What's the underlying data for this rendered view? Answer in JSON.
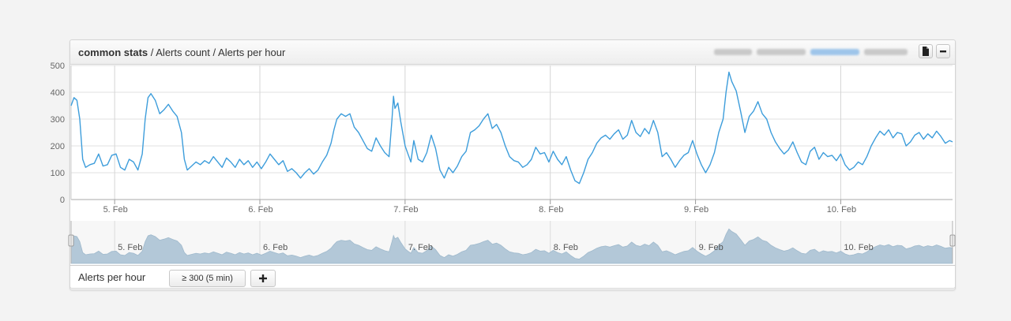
{
  "header": {
    "path_bold": "common stats",
    "path_rest": " / Alerts count / Alerts per hour"
  },
  "footer": {
    "series_label": "Alerts per hour",
    "threshold_button": "≥ 300 (5 min)",
    "add_button": "+"
  },
  "icons": {
    "doc": "document-icon",
    "minimize": "minus-icon",
    "add": "plus-icon"
  },
  "colors": {
    "line": "#3d9ddb",
    "navigator_fill": "#b3c8d8",
    "grid": "#e2e2e2"
  },
  "chart_data": {
    "type": "line",
    "ylim": [
      0,
      500
    ],
    "yticks": [
      0,
      100,
      200,
      300,
      400,
      500
    ],
    "xlim_days": [
      4.7,
      10.77
    ],
    "xticks": [
      {
        "value": 5,
        "label": "5. Feb"
      },
      {
        "value": 6,
        "label": "6. Feb"
      },
      {
        "value": 7,
        "label": "7. Feb"
      },
      {
        "value": 8,
        "label": "8. Feb"
      },
      {
        "value": 9,
        "label": "9. Feb"
      },
      {
        "value": 10,
        "label": "10. Feb"
      }
    ],
    "series": [
      {
        "points": [
          [
            4.7,
            350
          ],
          [
            4.72,
            380
          ],
          [
            4.74,
            370
          ],
          [
            4.76,
            300
          ],
          [
            4.78,
            150
          ],
          [
            4.8,
            120
          ],
          [
            4.83,
            130
          ],
          [
            4.86,
            135
          ],
          [
            4.89,
            170
          ],
          [
            4.92,
            125
          ],
          [
            4.95,
            130
          ],
          [
            4.98,
            165
          ],
          [
            5.01,
            170
          ],
          [
            5.04,
            120
          ],
          [
            5.07,
            110
          ],
          [
            5.1,
            150
          ],
          [
            5.13,
            140
          ],
          [
            5.16,
            110
          ],
          [
            5.19,
            170
          ],
          [
            5.21,
            300
          ],
          [
            5.23,
            380
          ],
          [
            5.25,
            395
          ],
          [
            5.28,
            370
          ],
          [
            5.31,
            320
          ],
          [
            5.34,
            335
          ],
          [
            5.37,
            355
          ],
          [
            5.4,
            330
          ],
          [
            5.43,
            310
          ],
          [
            5.46,
            250
          ],
          [
            5.48,
            150
          ],
          [
            5.5,
            110
          ],
          [
            5.53,
            125
          ],
          [
            5.56,
            140
          ],
          [
            5.59,
            130
          ],
          [
            5.62,
            145
          ],
          [
            5.65,
            135
          ],
          [
            5.68,
            160
          ],
          [
            5.71,
            140
          ],
          [
            5.74,
            120
          ],
          [
            5.77,
            155
          ],
          [
            5.8,
            140
          ],
          [
            5.83,
            120
          ],
          [
            5.86,
            150
          ],
          [
            5.89,
            130
          ],
          [
            5.92,
            145
          ],
          [
            5.95,
            120
          ],
          [
            5.98,
            140
          ],
          [
            6.01,
            115
          ],
          [
            6.04,
            140
          ],
          [
            6.07,
            170
          ],
          [
            6.1,
            150
          ],
          [
            6.13,
            130
          ],
          [
            6.16,
            145
          ],
          [
            6.19,
            105
          ],
          [
            6.22,
            115
          ],
          [
            6.25,
            100
          ],
          [
            6.28,
            80
          ],
          [
            6.31,
            100
          ],
          [
            6.34,
            115
          ],
          [
            6.37,
            95
          ],
          [
            6.4,
            110
          ],
          [
            6.43,
            140
          ],
          [
            6.46,
            165
          ],
          [
            6.49,
            210
          ],
          [
            6.51,
            260
          ],
          [
            6.53,
            300
          ],
          [
            6.56,
            320
          ],
          [
            6.59,
            310
          ],
          [
            6.62,
            320
          ],
          [
            6.65,
            270
          ],
          [
            6.68,
            250
          ],
          [
            6.71,
            220
          ],
          [
            6.74,
            190
          ],
          [
            6.77,
            180
          ],
          [
            6.8,
            230
          ],
          [
            6.83,
            200
          ],
          [
            6.86,
            175
          ],
          [
            6.89,
            160
          ],
          [
            6.91,
            300
          ],
          [
            6.92,
            385
          ],
          [
            6.93,
            340
          ],
          [
            6.95,
            360
          ],
          [
            6.97,
            290
          ],
          [
            7.0,
            200
          ],
          [
            7.02,
            170
          ],
          [
            7.04,
            140
          ],
          [
            7.06,
            220
          ],
          [
            7.09,
            150
          ],
          [
            7.12,
            140
          ],
          [
            7.15,
            175
          ],
          [
            7.18,
            240
          ],
          [
            7.21,
            190
          ],
          [
            7.24,
            110
          ],
          [
            7.27,
            80
          ],
          [
            7.3,
            120
          ],
          [
            7.33,
            100
          ],
          [
            7.36,
            125
          ],
          [
            7.39,
            160
          ],
          [
            7.42,
            180
          ],
          [
            7.45,
            250
          ],
          [
            7.48,
            260
          ],
          [
            7.51,
            275
          ],
          [
            7.54,
            300
          ],
          [
            7.57,
            320
          ],
          [
            7.6,
            265
          ],
          [
            7.63,
            280
          ],
          [
            7.66,
            250
          ],
          [
            7.69,
            200
          ],
          [
            7.72,
            160
          ],
          [
            7.75,
            145
          ],
          [
            7.78,
            140
          ],
          [
            7.81,
            120
          ],
          [
            7.84,
            130
          ],
          [
            7.87,
            150
          ],
          [
            7.9,
            195
          ],
          [
            7.93,
            170
          ],
          [
            7.96,
            175
          ],
          [
            7.99,
            140
          ],
          [
            8.02,
            180
          ],
          [
            8.05,
            150
          ],
          [
            8.08,
            130
          ],
          [
            8.11,
            160
          ],
          [
            8.14,
            110
          ],
          [
            8.17,
            70
          ],
          [
            8.2,
            60
          ],
          [
            8.23,
            100
          ],
          [
            8.26,
            150
          ],
          [
            8.29,
            175
          ],
          [
            8.32,
            210
          ],
          [
            8.35,
            230
          ],
          [
            8.38,
            240
          ],
          [
            8.41,
            225
          ],
          [
            8.44,
            245
          ],
          [
            8.47,
            260
          ],
          [
            8.5,
            225
          ],
          [
            8.53,
            240
          ],
          [
            8.56,
            295
          ],
          [
            8.59,
            250
          ],
          [
            8.62,
            235
          ],
          [
            8.65,
            265
          ],
          [
            8.68,
            245
          ],
          [
            8.71,
            295
          ],
          [
            8.74,
            250
          ],
          [
            8.77,
            160
          ],
          [
            8.8,
            175
          ],
          [
            8.83,
            150
          ],
          [
            8.86,
            120
          ],
          [
            8.89,
            145
          ],
          [
            8.92,
            165
          ],
          [
            8.95,
            175
          ],
          [
            8.98,
            220
          ],
          [
            9.01,
            170
          ],
          [
            9.04,
            130
          ],
          [
            9.07,
            100
          ],
          [
            9.1,
            130
          ],
          [
            9.13,
            175
          ],
          [
            9.16,
            250
          ],
          [
            9.19,
            300
          ],
          [
            9.21,
            400
          ],
          [
            9.23,
            475
          ],
          [
            9.25,
            440
          ],
          [
            9.28,
            405
          ],
          [
            9.31,
            330
          ],
          [
            9.34,
            250
          ],
          [
            9.37,
            310
          ],
          [
            9.4,
            330
          ],
          [
            9.43,
            365
          ],
          [
            9.46,
            320
          ],
          [
            9.49,
            300
          ],
          [
            9.52,
            250
          ],
          [
            9.55,
            215
          ],
          [
            9.58,
            190
          ],
          [
            9.61,
            170
          ],
          [
            9.64,
            185
          ],
          [
            9.67,
            215
          ],
          [
            9.7,
            175
          ],
          [
            9.73,
            140
          ],
          [
            9.76,
            130
          ],
          [
            9.79,
            180
          ],
          [
            9.82,
            195
          ],
          [
            9.85,
            150
          ],
          [
            9.88,
            175
          ],
          [
            9.91,
            160
          ],
          [
            9.94,
            165
          ],
          [
            9.97,
            145
          ],
          [
            10.0,
            170
          ],
          [
            10.03,
            130
          ],
          [
            10.06,
            110
          ],
          [
            10.09,
            120
          ],
          [
            10.12,
            140
          ],
          [
            10.15,
            130
          ],
          [
            10.18,
            160
          ],
          [
            10.21,
            200
          ],
          [
            10.24,
            230
          ],
          [
            10.27,
            255
          ],
          [
            10.3,
            240
          ],
          [
            10.33,
            260
          ],
          [
            10.36,
            230
          ],
          [
            10.39,
            250
          ],
          [
            10.42,
            245
          ],
          [
            10.45,
            200
          ],
          [
            10.48,
            215
          ],
          [
            10.51,
            240
          ],
          [
            10.54,
            250
          ],
          [
            10.57,
            225
          ],
          [
            10.6,
            245
          ],
          [
            10.63,
            230
          ],
          [
            10.66,
            255
          ],
          [
            10.69,
            235
          ],
          [
            10.72,
            210
          ],
          [
            10.75,
            220
          ],
          [
            10.77,
            215
          ]
        ]
      }
    ]
  }
}
